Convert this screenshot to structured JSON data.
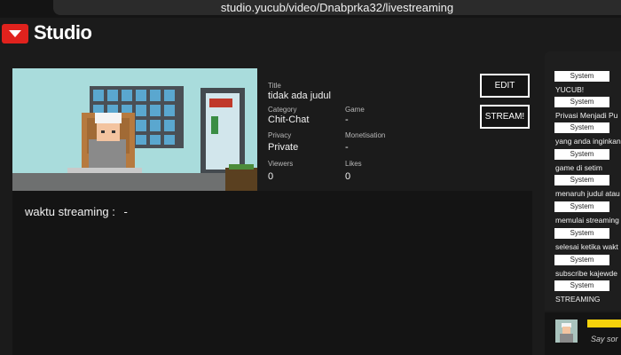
{
  "browser": {
    "url": "studio.yucub/video/Dnabprka32/livestreaming"
  },
  "header": {
    "brand": "Studio"
  },
  "video": {
    "title_label": "Title",
    "title": "tidak ada judul",
    "category_label": "Category",
    "category": "Chit-Chat",
    "game_label": "Game",
    "game": "-",
    "privacy_label": "Privacy",
    "privacy": "Private",
    "monetisation_label": "Monetisation",
    "monetisation": "-",
    "viewers_label": "Viewers",
    "viewers": "0",
    "likes_label": "Likes",
    "likes": "0"
  },
  "actions": {
    "edit_label": "EDIT",
    "stream_label": "STREAM!"
  },
  "streaming": {
    "label": "waktu streaming :",
    "value": "-"
  },
  "chat": {
    "messages": [
      {
        "user": "System",
        "text": "YUCUB!"
      },
      {
        "user": "System",
        "text": "Privasi Menjadi Pu"
      },
      {
        "user": "System",
        "text": "yang anda inginkan"
      },
      {
        "user": "System",
        "text": "game di setim"
      },
      {
        "user": "System",
        "text": "menaruh judul atau"
      },
      {
        "user": "System",
        "text": "memulai streaming"
      },
      {
        "user": "System",
        "text": "selesai ketika wakt"
      },
      {
        "user": "System",
        "text": "subscribe kajewde"
      },
      {
        "user": "System",
        "text": "STREAMING"
      }
    ],
    "input_placeholder": "Say sor"
  },
  "colors": {
    "brand_red": "#e0221d",
    "chat_accent": "#f6d20b"
  }
}
